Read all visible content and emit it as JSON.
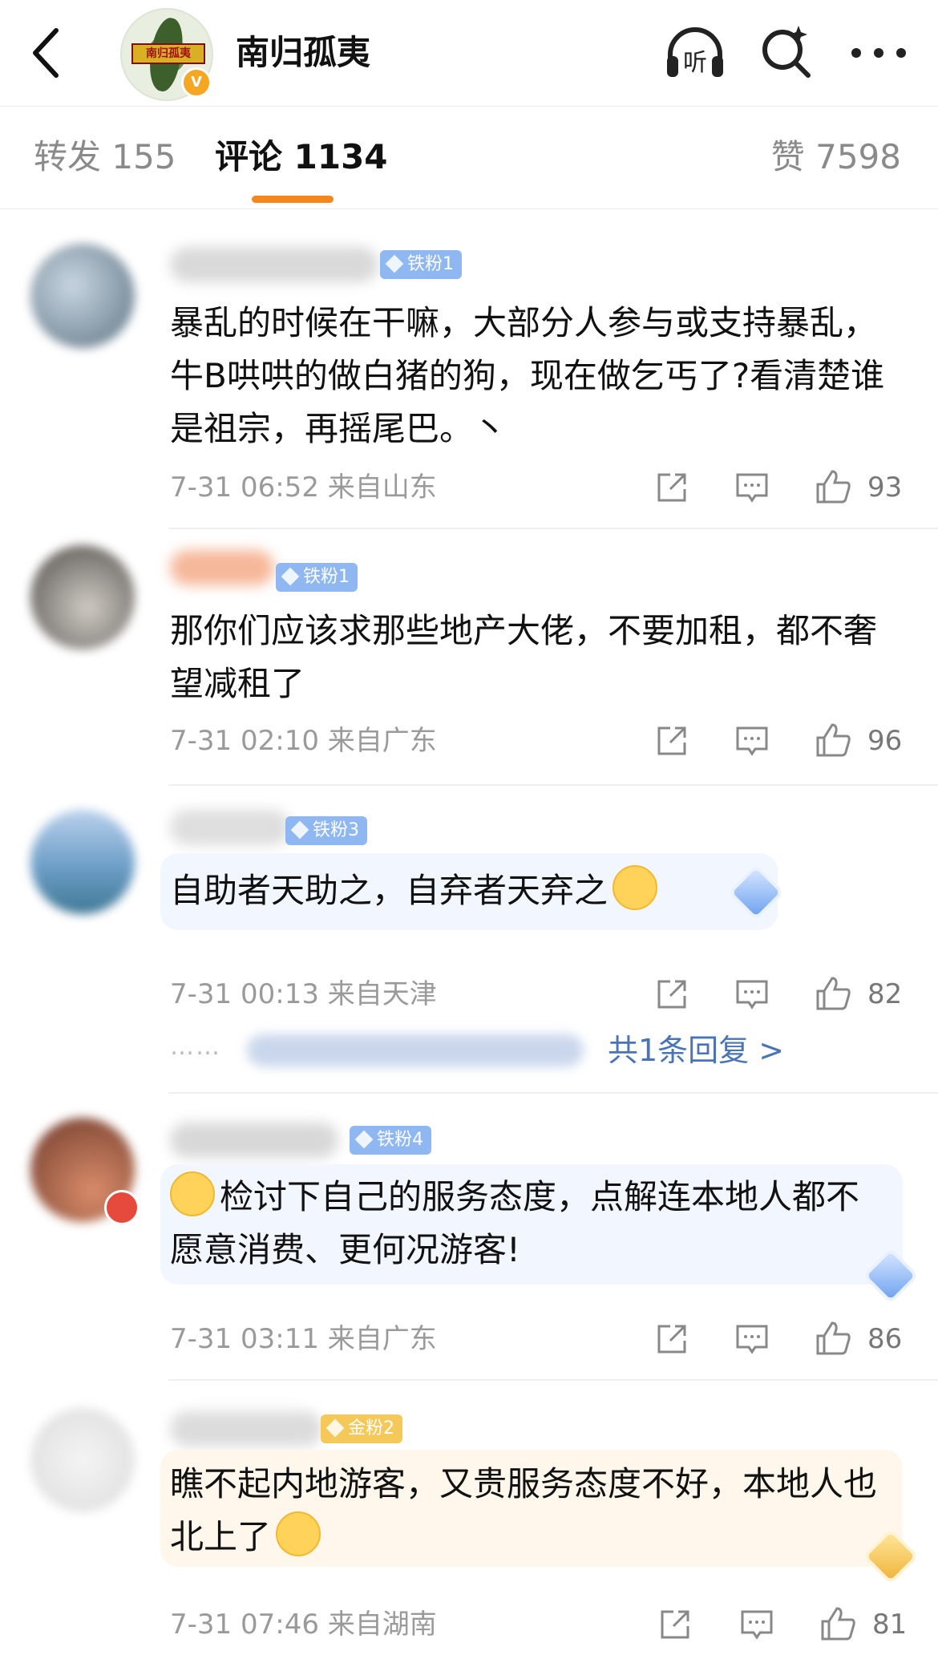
{
  "header": {
    "title": "南归孤夷",
    "avatar_banner": "南归孤夷",
    "verified_badge": "V",
    "icons": [
      "back-arrow-icon",
      "listen-headphones-icon",
      "search-sparkle-icon",
      "more-dots-icon"
    ],
    "listen_label": "听"
  },
  "tabs": {
    "reposts": "转发 155",
    "comments": "评论 1134",
    "likes": "赞 7598",
    "active": "comments",
    "accent_color": "#f7861d"
  },
  "comments": [
    {
      "badge": "铁粉1",
      "text": "暴乱的时候在干嘛，大部分人参与或支持暴乱，牛B哄哄的做白猪的狗，现在做乞丐了?看清楚谁是祖宗，再摇尾巴。丶",
      "date": "7-31 06:52",
      "location": "来自山东",
      "likes": "93"
    },
    {
      "badge": "铁粉1",
      "text": "那你们应该求那些地产大佬，不要加租，都不奢望减租了",
      "date": "7-31 02:10",
      "location": "来自广东",
      "likes": "96"
    },
    {
      "badge": "铁粉3",
      "text": "自助者天助之，自弃者天弃之",
      "date": "7-31 00:13",
      "location": "来自天津",
      "likes": "82",
      "reply_dots": "……",
      "reply_link": "共1条回复 >"
    },
    {
      "badge": "铁粉4",
      "text": "检讨下自己的服务态度，点解连本地人都不愿意消费、更何况游客!",
      "date": "7-31 03:11",
      "location": "来自广东",
      "likes": "86"
    },
    {
      "badge": "金粉2",
      "text": "瞧不起内地游客，又贵服务态度不好，本地人也北上了",
      "date": "7-31 07:46",
      "location": "来自湖南",
      "likes": "81"
    }
  ]
}
